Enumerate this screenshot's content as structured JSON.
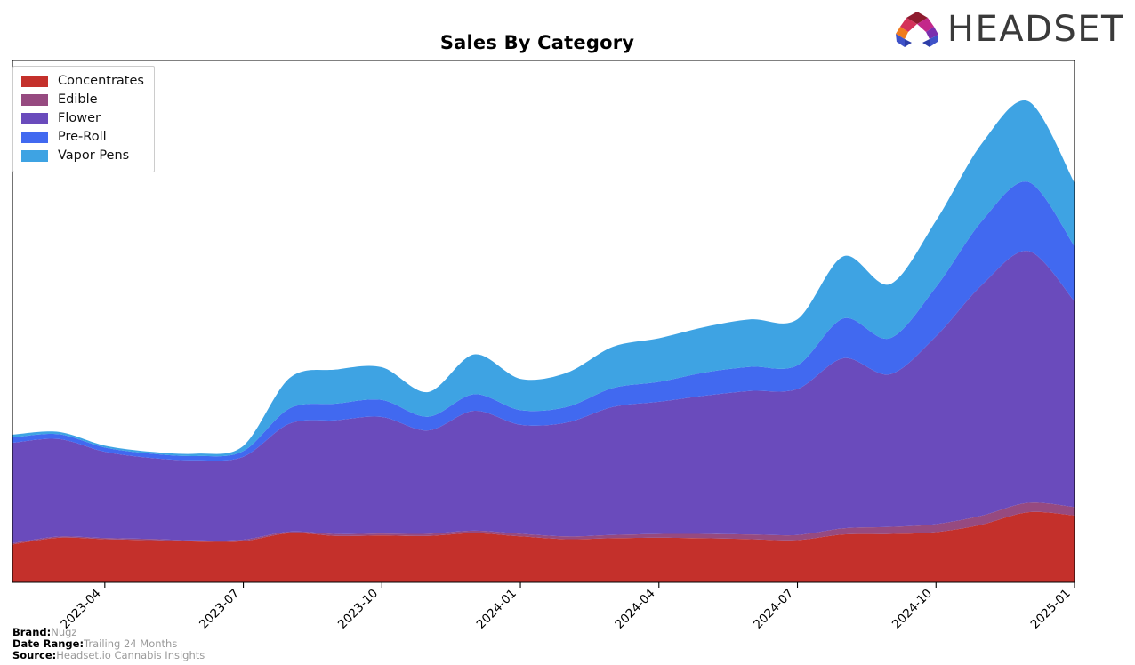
{
  "header": {
    "title": "Sales By Category",
    "logo_text": "HEADSET",
    "logo_icon": "headset-arch-logo"
  },
  "legend": {
    "position": "top-left",
    "entries": [
      {
        "label": "Concentrates",
        "color": "#c4302b"
      },
      {
        "label": "Edible",
        "color": "#964a80"
      },
      {
        "label": "Flower",
        "color": "#6a4bbc"
      },
      {
        "label": "Pre-Roll",
        "color": "#4169f0"
      },
      {
        "label": "Vapor Pens",
        "color": "#3ea3e3"
      }
    ]
  },
  "footer": {
    "rows": [
      {
        "key": "Brand:",
        "value": "Nugz"
      },
      {
        "key": "Date Range:",
        "value": "Trailing 24 Months"
      },
      {
        "key": "Source:",
        "value": "Headset.io Cannabis Insights"
      }
    ]
  },
  "chart_data": {
    "type": "area",
    "title": "Sales By Category",
    "xlabel": "",
    "ylabel": "",
    "stacked": true,
    "smoothing": "spline",
    "grid": false,
    "legend_position": "upper left",
    "axis": {
      "x_tick_labels": [
        "2023-04",
        "2023-07",
        "2023-10",
        "2024-01",
        "2024-04",
        "2024-07",
        "2024-10",
        "2025-01"
      ],
      "x_tick_rotation": -45,
      "y_axis_visible": false,
      "y_tick_labels": [],
      "ylim": [
        0,
        100
      ]
    },
    "x": [
      "2023-02",
      "2023-03",
      "2023-04",
      "2023-05",
      "2023-06",
      "2023-07",
      "2023-08",
      "2023-09",
      "2023-10",
      "2023-11",
      "2023-12",
      "2024-01",
      "2024-02",
      "2024-03",
      "2024-04",
      "2024-05",
      "2024-06",
      "2024-07",
      "2024-08",
      "2024-09",
      "2024-10",
      "2024-11",
      "2024-12",
      "2025-01"
    ],
    "series": [
      {
        "name": "Concentrates",
        "color": "#c4302b",
        "values": [
          8.0,
          9.4,
          9.1,
          8.9,
          8.6,
          8.7,
          10.4,
          9.8,
          9.9,
          9.8,
          10.4,
          9.7,
          9.1,
          9.3,
          9.4,
          9.3,
          9.1,
          8.9,
          10.1,
          10.2,
          10.6,
          12.2,
          14.8,
          14.1
        ]
      },
      {
        "name": "Edible",
        "color": "#964a80",
        "values": [
          0.25,
          0.25,
          0.25,
          0.25,
          0.25,
          0.3,
          0.3,
          0.4,
          0.4,
          0.45,
          0.5,
          0.55,
          0.6,
          0.7,
          0.8,
          0.9,
          1.0,
          1.1,
          1.3,
          1.5,
          1.7,
          1.9,
          2.0,
          1.8
        ]
      },
      {
        "name": "Flower",
        "color": "#6a4bbc",
        "values": [
          21.2,
          20.6,
          18.2,
          17.1,
          16.9,
          17.5,
          22.8,
          24.0,
          24.6,
          21.8,
          25.3,
          23.0,
          24.0,
          27.0,
          27.9,
          29.2,
          30.3,
          30.8,
          35.9,
          32.2,
          39.6,
          48.7,
          53.1,
          43.4
        ]
      },
      {
        "name": "Pre-Roll",
        "color": "#4169f0",
        "values": [
          1.1,
          1.0,
          0.9,
          0.9,
          0.9,
          1.2,
          3.2,
          3.5,
          3.6,
          2.9,
          3.5,
          3.1,
          3.3,
          4.0,
          4.2,
          4.9,
          5.1,
          5.0,
          8.4,
          7.6,
          10.4,
          13.5,
          14.6,
          11.6
        ]
      },
      {
        "name": "Vapor Pens",
        "color": "#3ea3e3",
        "values": [
          0.6,
          0.5,
          0.4,
          0.4,
          0.5,
          1.1,
          6.4,
          7.2,
          6.9,
          5.2,
          8.4,
          6.6,
          7.2,
          8.7,
          9.2,
          9.6,
          10.0,
          9.7,
          13.1,
          11.4,
          14.0,
          16.4,
          17.0,
          13.4
        ]
      }
    ]
  }
}
